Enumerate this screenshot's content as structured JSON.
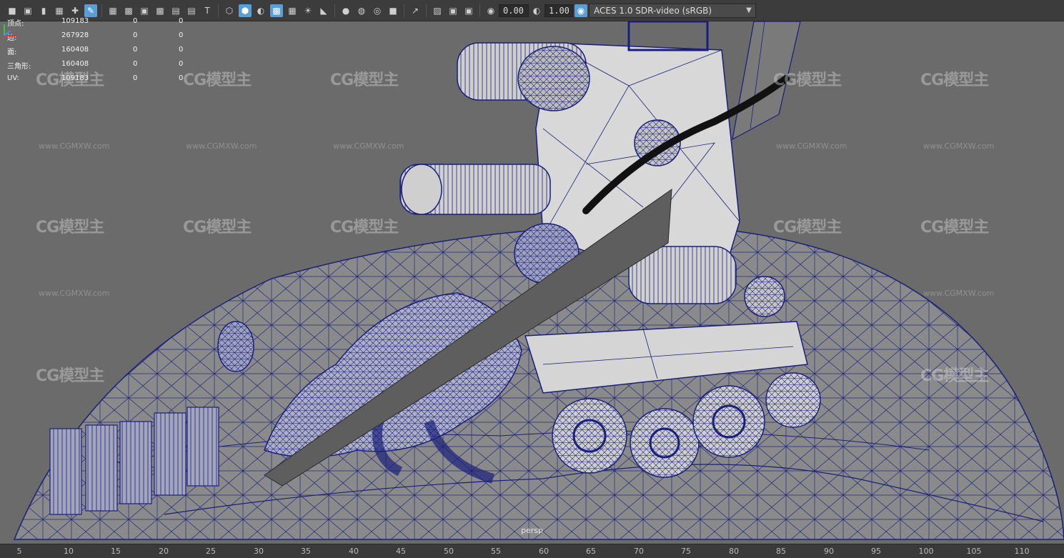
{
  "toolbar": {
    "icons": [
      "camera-icon",
      "camera-attributes-icon",
      "bookmark-icon",
      "image-plane-icon",
      "grid-icon",
      "pencil-icon",
      "wireframe-icon",
      "resolution-gate-icon",
      "gate-mask-icon",
      "field-chart-icon",
      "safe-action-icon",
      "safe-title-icon",
      "wireframe-shaded-icon",
      "smooth-shade-icon",
      "default-material-icon",
      "textured-icon",
      "lights-icon",
      "shadows-icon",
      "ambient-occlusion-icon",
      "motion-blur-icon",
      "anti-alias-icon",
      "depth-of-field-icon",
      "xray-icon",
      "xray-joints-icon",
      "isolate-select-icon",
      "camera-sync-icon",
      "exposure-icon",
      "gamma-icon",
      "color-management-icon"
    ],
    "exposure": "0.00",
    "gamma": "1.00",
    "color_space": "ACES 1.0 SDR-video (sRGB)"
  },
  "hud": {
    "rows": [
      {
        "label": "顶点:",
        "value": "109183",
        "a": "0",
        "b": "0"
      },
      {
        "label": "边:",
        "value": "267928",
        "a": "0",
        "b": "0"
      },
      {
        "label": "面:",
        "value": "160408",
        "a": "0",
        "b": "0"
      },
      {
        "label": "三角形:",
        "value": "160408",
        "a": "0",
        "b": "0"
      },
      {
        "label": "UV:",
        "value": "109183",
        "a": "0",
        "b": "0"
      }
    ]
  },
  "watermark": {
    "logo": "CG模型主",
    "url": "www.CGMXW.com"
  },
  "camera_label": "persp",
  "ruler": {
    "ticks": [
      "5",
      "10",
      "15",
      "20",
      "25",
      "30",
      "35",
      "40",
      "45",
      "50",
      "55",
      "60",
      "65",
      "70",
      "75",
      "80",
      "85",
      "90",
      "95",
      "100",
      "105",
      "110"
    ]
  },
  "colors": {
    "viewport_bg": "#6b6b6b",
    "wire": "#1a1f7a",
    "mesh_fill": "#c9c9c9",
    "highlight": "#5a9ed6"
  }
}
